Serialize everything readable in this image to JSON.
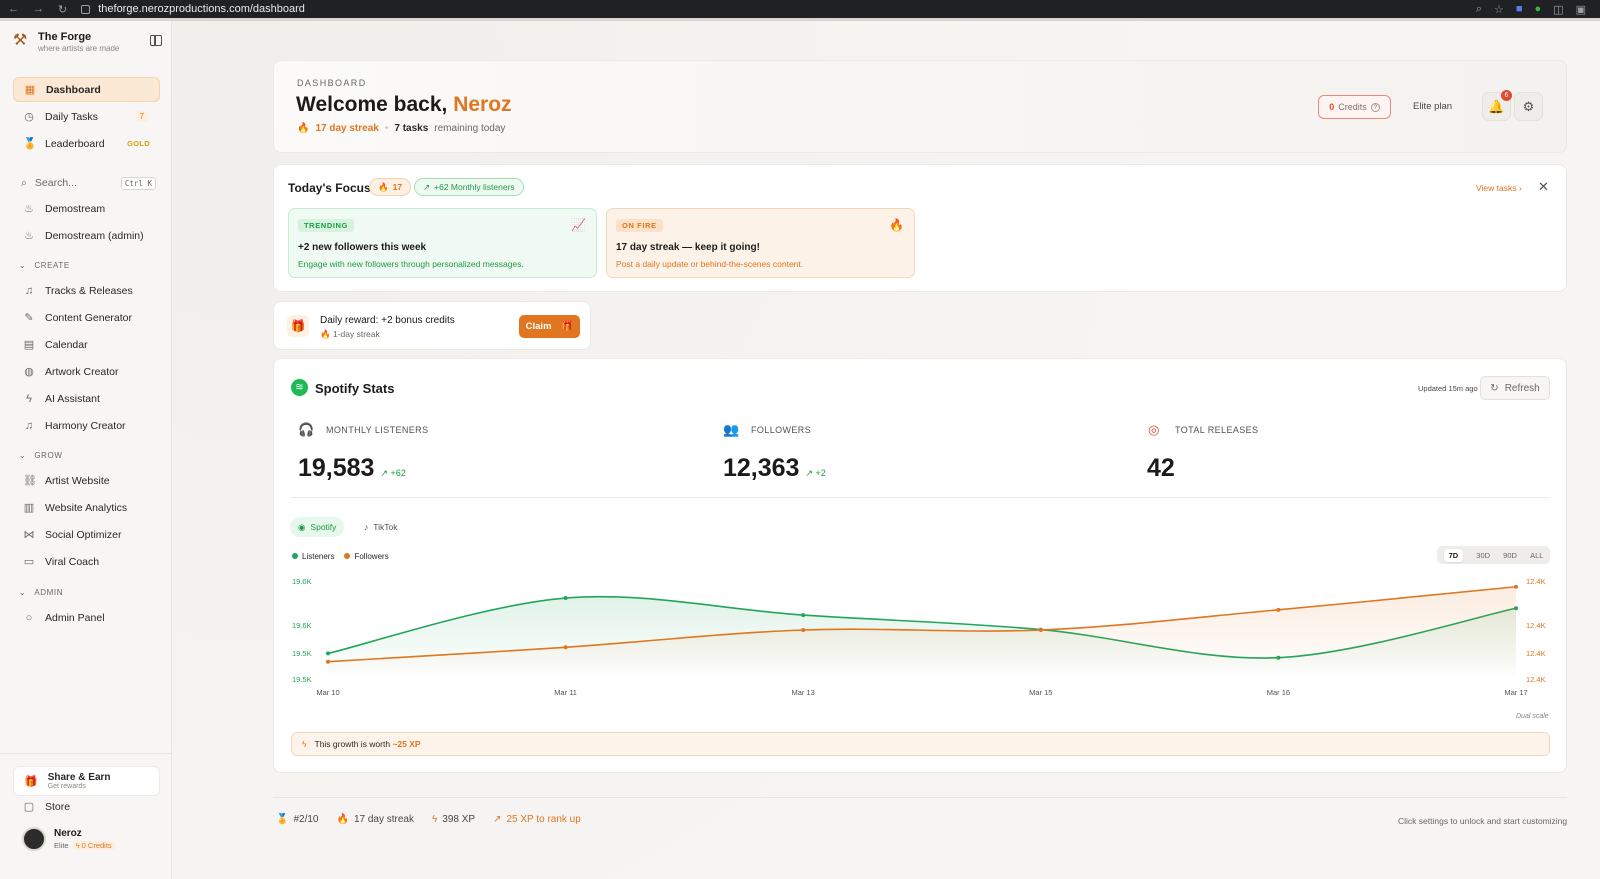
{
  "browser": {
    "url": "theforge.nerozproductions.com/dashboard"
  },
  "brand": {
    "title": "The Forge",
    "tagline": "where artists are made"
  },
  "sidebar": {
    "nav": [
      {
        "label": "Dashboard",
        "icon": "grid-icon"
      },
      {
        "label": "Daily Tasks",
        "icon": "clock-icon",
        "badge": "7"
      },
      {
        "label": "Leaderboard",
        "icon": "medal-icon",
        "badge": "GOLD"
      }
    ],
    "search": {
      "placeholder": "Search...",
      "shortcut": "Ctrl K"
    },
    "streams": [
      {
        "label": "Demostream"
      },
      {
        "label": "Demostream (admin)"
      }
    ],
    "sections": {
      "create": {
        "label": "CREATE",
        "items": [
          "Tracks & Releases",
          "Content Generator",
          "Calendar",
          "Artwork Creator",
          "AI Assistant",
          "Harmony Creator"
        ]
      },
      "grow": {
        "label": "GROW",
        "items": [
          "Artist Website",
          "Website Analytics",
          "Social Optimizer",
          "Viral Coach"
        ]
      },
      "admin": {
        "label": "ADMIN",
        "items": [
          "Admin Panel"
        ]
      }
    },
    "share": {
      "title": "Share & Earn",
      "subtitle": "Get rewards"
    },
    "store": "Store",
    "user": {
      "name": "Neroz",
      "plan": "Elite",
      "credits": "0 Credits"
    }
  },
  "header": {
    "eyebrow": "DASHBOARD",
    "welcome": "Welcome back,",
    "name": "Neroz",
    "streak": "17 day streak",
    "tasks_bold": "7 tasks",
    "tasks_rest": "remaining today",
    "credits_value": "0",
    "credits_label": "Credits",
    "plan": "Elite plan",
    "notifications": "6"
  },
  "focus": {
    "title": "Today's Focus",
    "chip_streak": "17",
    "chip_listeners": "+62 Monthly listeners",
    "view_tasks": "View tasks",
    "tiles": [
      {
        "tag": "TRENDING",
        "headline": "+2 new followers this week",
        "text": "Engage with new followers through personalized messages."
      },
      {
        "tag": "ON FIRE",
        "headline": "17 day streak — keep it going!",
        "text": "Post a daily update or behind-the-scenes content."
      }
    ]
  },
  "reward": {
    "title": "Daily reward: +2 bonus credits",
    "subtitle": "1-day streak",
    "button": "Claim"
  },
  "stats": {
    "title": "Spotify Stats",
    "updated": "Updated 15m ago",
    "refresh": "Refresh",
    "metrics": [
      {
        "label": "MONTHLY LISTENERS",
        "value": "19,583",
        "delta": "+62"
      },
      {
        "label": "FOLLOWERS",
        "value": "12,363",
        "delta": "+2"
      },
      {
        "label": "TOTAL RELEASES",
        "value": "42",
        "delta": ""
      }
    ],
    "tabs": [
      "Spotify",
      "TikTok"
    ],
    "legend": [
      "Listeners",
      "Followers"
    ],
    "ranges": [
      "7D",
      "30D",
      "90D",
      "ALL"
    ],
    "dual_scale": "Dual scale",
    "xp_text": "This growth is worth",
    "xp_value": "~25 XP"
  },
  "chart_data": {
    "type": "line",
    "x": [
      "Mar 10",
      "Mar 11",
      "Mar 13",
      "Mar 15",
      "Mar 16",
      "Mar 17"
    ],
    "series": [
      {
        "name": "Listeners",
        "axis": "left",
        "color": "#22a55a",
        "values": [
          19530,
          19595,
          19575,
          19558,
          19525,
          19583
        ]
      },
      {
        "name": "Followers",
        "axis": "right",
        "color": "#e0761f",
        "values": [
          12350.0,
          12352.5,
          12355.5,
          12355.5,
          12359.0,
          12363.0
        ]
      }
    ],
    "left_ticks": [
      "19.6K",
      "19.6K",
      "19.5K",
      "19.5K"
    ],
    "right_ticks": [
      "12.4K",
      "12.4K",
      "12.4K",
      "12.4K"
    ],
    "left_range": [
      19500,
      19615
    ],
    "right_range": [
      12347,
      12364
    ],
    "legend_position": "top-left"
  },
  "footer": {
    "rank": "#2/10",
    "streak": "17 day streak",
    "xp": "398 XP",
    "rank_up": "25 XP to rank up",
    "hint": "Click settings to unlock and start customizing"
  },
  "colors": {
    "accent": "#e0761f",
    "spotify": "#1db954",
    "positive": "#1f9a45",
    "danger": "#e04a2f"
  }
}
